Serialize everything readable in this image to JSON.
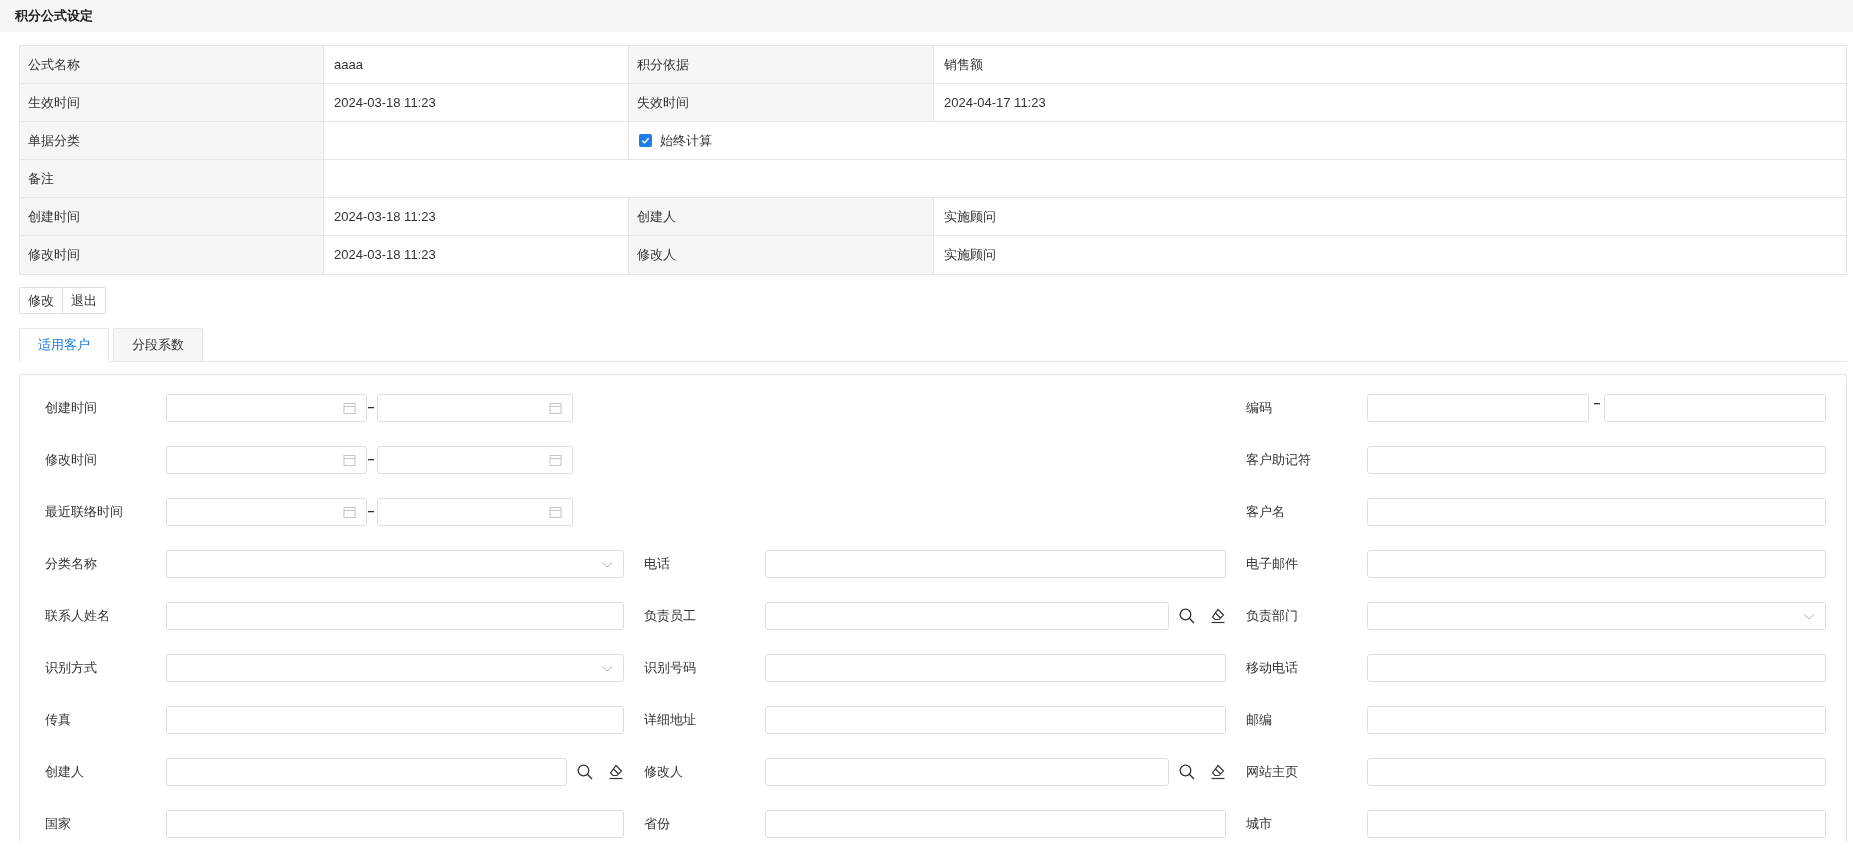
{
  "header": {
    "title": "积分公式设定"
  },
  "info_table": {
    "rows": [
      {
        "cells": [
          {
            "kind": "label",
            "text": "公式名称"
          },
          {
            "kind": "value",
            "text": "aaaa"
          },
          {
            "kind": "label",
            "text": "积分依据"
          },
          {
            "kind": "value",
            "text": "销售额"
          }
        ]
      },
      {
        "cells": [
          {
            "kind": "label",
            "text": "生效时间"
          },
          {
            "kind": "value",
            "text": "2024-03-18 11:23"
          },
          {
            "kind": "label",
            "text": "失效时间"
          },
          {
            "kind": "value",
            "text": "2024-04-17 11:23"
          }
        ]
      },
      {
        "cells": [
          {
            "kind": "label",
            "text": "单据分类"
          },
          {
            "kind": "value"
          },
          {
            "kind": "checkbox",
            "text": "始终计算",
            "checked": true
          }
        ]
      },
      {
        "cells": [
          {
            "kind": "label",
            "text": "备注"
          },
          {
            "kind": "value"
          }
        ]
      },
      {
        "cells": [
          {
            "kind": "label",
            "text": "创建时间"
          },
          {
            "kind": "value",
            "text": "2024-03-18 11:23"
          },
          {
            "kind": "label",
            "text": "创建人"
          },
          {
            "kind": "value",
            "text": "实施顾问"
          }
        ]
      },
      {
        "cells": [
          {
            "kind": "label",
            "text": "修改时间"
          },
          {
            "kind": "value",
            "text": "2024-03-18 11:23"
          },
          {
            "kind": "label",
            "text": "修改人"
          },
          {
            "kind": "value",
            "text": "实施顾问"
          }
        ]
      }
    ]
  },
  "buttons": [
    "修改",
    "退出"
  ],
  "tabs": [
    {
      "label": "适用客户",
      "selected": true
    },
    {
      "label": "分段系数",
      "selected": false
    }
  ],
  "form": {
    "rows": [
      {
        "fields": [
          {
            "label": "创建时间",
            "kind": "date_range"
          },
          {
            "label": "编码",
            "kind": "text_range"
          }
        ]
      },
      {
        "fields": [
          {
            "label": "修改时间",
            "kind": "date_range"
          },
          {
            "label": "客户助记符",
            "kind": "text"
          }
        ]
      },
      {
        "fields": [
          {
            "label": "最近联络时间",
            "kind": "date_range"
          },
          {
            "label": "客户名",
            "kind": "text"
          }
        ]
      },
      {
        "fields": [
          {
            "label": "分类名称",
            "kind": "select"
          },
          {
            "label": "电话",
            "kind": "text"
          },
          {
            "label": "电子邮件",
            "kind": "text"
          }
        ]
      },
      {
        "fields": [
          {
            "label": "联系人姓名",
            "kind": "text"
          },
          {
            "label": "负责员工",
            "kind": "lookup"
          },
          {
            "label": "负责部门",
            "kind": "select"
          }
        ]
      },
      {
        "fields": [
          {
            "label": "识别方式",
            "kind": "select"
          },
          {
            "label": "识别号码",
            "kind": "text"
          },
          {
            "label": "移动电话",
            "kind": "text"
          }
        ]
      },
      {
        "fields": [
          {
            "label": "传真",
            "kind": "text"
          },
          {
            "label": "详细地址",
            "kind": "text"
          },
          {
            "label": "邮编",
            "kind": "text"
          }
        ]
      },
      {
        "fields": [
          {
            "label": "创建人",
            "kind": "lookup"
          },
          {
            "label": "修改人",
            "kind": "lookup"
          },
          {
            "label": "网站主页",
            "kind": "text"
          }
        ]
      },
      {
        "fields": [
          {
            "label": "国家",
            "kind": "text"
          },
          {
            "label": "省份",
            "kind": "text"
          },
          {
            "label": "城市",
            "kind": "text"
          }
        ]
      }
    ]
  }
}
